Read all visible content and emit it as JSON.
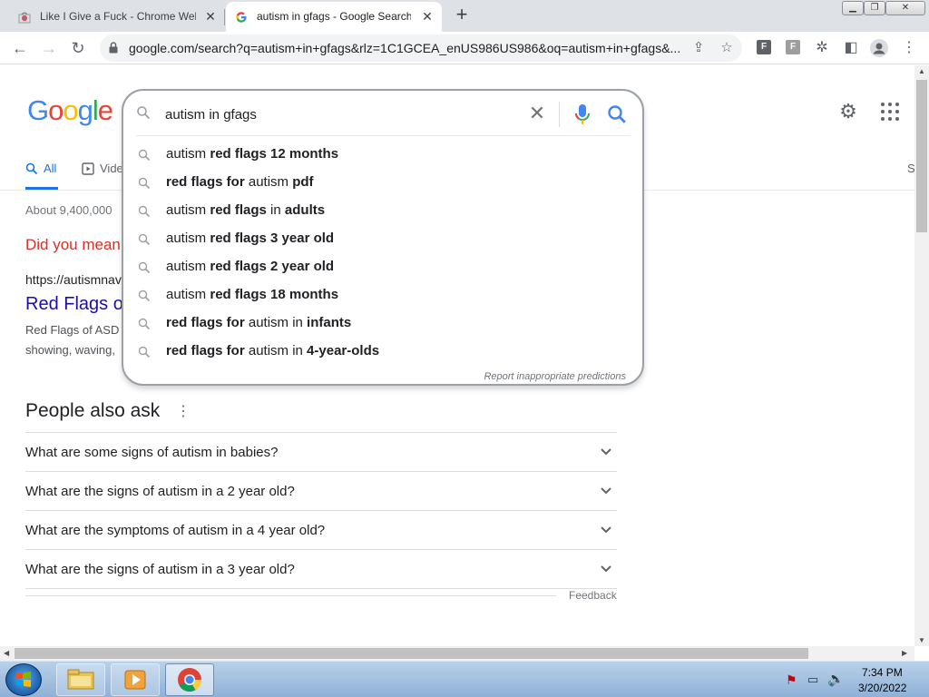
{
  "browser": {
    "tabs": [
      {
        "title": "Like I Give a Fuck - Chrome Web",
        "close": "✕"
      },
      {
        "title": "autism in gfags - Google Search",
        "close": "✕"
      }
    ],
    "new_tab": "+",
    "url": "google.com/search?q=autism+in+gfags&rlz=1C1GCEA_enUS986US986&oq=autism+in+gfags&...",
    "extension_1": "F",
    "extension_2": "F"
  },
  "search": {
    "query": "autism in gfags",
    "suggestions": [
      {
        "pre": "autism ",
        "bold": "red flags 12 months",
        "mid": "",
        "bold2": ""
      },
      {
        "pre": "",
        "bold": "red flags for",
        "mid": " autism ",
        "bold2": "pdf"
      },
      {
        "pre": "autism ",
        "bold": "red flags",
        "mid": " in ",
        "bold2": "adults"
      },
      {
        "pre": "autism ",
        "bold": "red flags 3 year old",
        "mid": "",
        "bold2": ""
      },
      {
        "pre": "autism ",
        "bold": "red flags 2 year old",
        "mid": "",
        "bold2": ""
      },
      {
        "pre": "autism ",
        "bold": "red flags 18 months",
        "mid": "",
        "bold2": ""
      },
      {
        "pre": "",
        "bold": "red flags for",
        "mid": " autism in ",
        "bold2": "infants"
      },
      {
        "pre": "",
        "bold": "red flags for",
        "mid": " autism in ",
        "bold2": "4-year-olds"
      }
    ],
    "report": "Report inappropriate predictions"
  },
  "nav": {
    "tab_all": "All",
    "tab_videos": "Vide",
    "right_cut": "S"
  },
  "results": {
    "stats": "About 9,400,000",
    "did_you_mean": "Did you mean",
    "result_url": "https://autismnav",
    "result_title": "Red Flags o",
    "snippet_1": "Red Flags of ASD",
    "snippet_2": "showing, waving,"
  },
  "people_also_ask": {
    "heading": "People also ask",
    "questions": [
      "What are some signs of autism in babies?",
      "What are the signs of autism in a 2 year old?",
      "What are the symptoms of autism in a 4 year old?",
      "What are the signs of autism in a 3 year old?"
    ],
    "feedback": "Feedback"
  },
  "taskbar": {
    "time": "7:34 PM",
    "date": "3/20/2022"
  },
  "colors": {
    "google_blue": "#4285F4",
    "google_red": "#EA4335",
    "google_yellow": "#FBBC05",
    "google_green": "#34A853",
    "link_blue": "#1a0dab",
    "did_you_mean_red": "#d93025"
  }
}
